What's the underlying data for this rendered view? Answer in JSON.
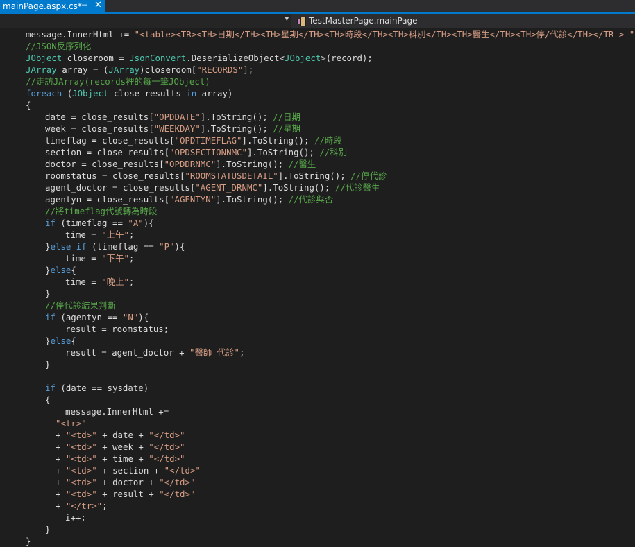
{
  "tab": {
    "title": "mainPage.aspx.cs*",
    "pin_glyph": "⊣",
    "close_glyph": "✕"
  },
  "navbar": {
    "member": "TestMasterPage.mainPage"
  },
  "code_lines": [
    {
      "indent": 0,
      "tokens": [
        [
          "pl",
          "message.InnerHtml += "
        ],
        [
          "st",
          "\"<table><TR><TH>日期</TH><TH>星期</TH><TH>時段</TH><TH>科別</TH><TH>醫生</TH><TH>停/代診</TH></TR > \""
        ],
        [
          "pl",
          ";"
        ]
      ]
    },
    {
      "indent": 0,
      "tokens": [
        [
          "cm",
          "//JSON反序列化"
        ]
      ]
    },
    {
      "indent": 0,
      "tokens": [
        [
          "ty",
          "JObject"
        ],
        [
          "pl",
          " closeroom = "
        ],
        [
          "ty",
          "JsonConvert"
        ],
        [
          "pl",
          ".DeserializeObject<"
        ],
        [
          "ty",
          "JObject"
        ],
        [
          "pl",
          ">(record);"
        ]
      ]
    },
    {
      "indent": 0,
      "tokens": [
        [
          "ty",
          "JArray"
        ],
        [
          "pl",
          " array = ("
        ],
        [
          "ty",
          "JArray"
        ],
        [
          "pl",
          ")closeroom["
        ],
        [
          "st",
          "\"RECORDS\""
        ],
        [
          "pl",
          "];"
        ]
      ]
    },
    {
      "indent": 0,
      "tokens": [
        [
          "cm",
          "//走訪JArray(records裡的每一筆JObject)"
        ]
      ]
    },
    {
      "indent": 0,
      "tokens": [
        [
          "kw",
          "foreach"
        ],
        [
          "pl",
          " ("
        ],
        [
          "ty",
          "JObject"
        ],
        [
          "pl",
          " close_results "
        ],
        [
          "kw",
          "in"
        ],
        [
          "pl",
          " array)"
        ]
      ]
    },
    {
      "indent": 0,
      "tokens": [
        [
          "pl",
          "{"
        ]
      ]
    },
    {
      "indent": 1,
      "tokens": [
        [
          "pl",
          "date = close_results["
        ],
        [
          "st",
          "\"OPDDATE\""
        ],
        [
          "pl",
          "].ToString(); "
        ],
        [
          "cm",
          "//日期"
        ]
      ]
    },
    {
      "indent": 1,
      "tokens": [
        [
          "pl",
          "week = close_results["
        ],
        [
          "st",
          "\"WEEKDAY\""
        ],
        [
          "pl",
          "].ToString(); "
        ],
        [
          "cm",
          "//星期"
        ]
      ]
    },
    {
      "indent": 1,
      "tokens": [
        [
          "pl",
          "timeflag = close_results["
        ],
        [
          "st",
          "\"OPDTIMEFLAG\""
        ],
        [
          "pl",
          "].ToString(); "
        ],
        [
          "cm",
          "//時段"
        ]
      ]
    },
    {
      "indent": 1,
      "tokens": [
        [
          "pl",
          "section = close_results["
        ],
        [
          "st",
          "\"OPDSECTIONNMC\""
        ],
        [
          "pl",
          "].ToString(); "
        ],
        [
          "cm",
          "//科別"
        ]
      ]
    },
    {
      "indent": 1,
      "tokens": [
        [
          "pl",
          "doctor = close_results["
        ],
        [
          "st",
          "\"OPDDRNMC\""
        ],
        [
          "pl",
          "].ToString(); "
        ],
        [
          "cm",
          "//醫生"
        ]
      ]
    },
    {
      "indent": 1,
      "tokens": [
        [
          "pl",
          "roomstatus = close_results["
        ],
        [
          "st",
          "\"ROOMSTATUSDETAIL\""
        ],
        [
          "pl",
          "].ToString(); "
        ],
        [
          "cm",
          "//停代診"
        ]
      ]
    },
    {
      "indent": 1,
      "tokens": [
        [
          "pl",
          "agent_doctor = close_results["
        ],
        [
          "st",
          "\"AGENT_DRNMC\""
        ],
        [
          "pl",
          "].ToString(); "
        ],
        [
          "cm",
          "//代診醫生"
        ]
      ]
    },
    {
      "indent": 1,
      "tokens": [
        [
          "pl",
          "agentyn = close_results["
        ],
        [
          "st",
          "\"AGENTYN\""
        ],
        [
          "pl",
          "].ToString(); "
        ],
        [
          "cm",
          "//代診與否"
        ]
      ]
    },
    {
      "indent": 1,
      "tokens": [
        [
          "cm",
          "//將timeflag代號轉為時段"
        ]
      ]
    },
    {
      "indent": 1,
      "tokens": [
        [
          "kw",
          "if"
        ],
        [
          "pl",
          " (timeflag == "
        ],
        [
          "st",
          "\"A\""
        ],
        [
          "pl",
          "){"
        ]
      ]
    },
    {
      "indent": 2,
      "tokens": [
        [
          "pl",
          "time = "
        ],
        [
          "st",
          "\"上午\""
        ],
        [
          "pl",
          ";"
        ]
      ]
    },
    {
      "indent": 1,
      "tokens": [
        [
          "pl",
          "}"
        ],
        [
          "kw",
          "else"
        ],
        [
          "pl",
          " "
        ],
        [
          "kw",
          "if"
        ],
        [
          "pl",
          " (timeflag == "
        ],
        [
          "st",
          "\"P\""
        ],
        [
          "pl",
          "){"
        ]
      ]
    },
    {
      "indent": 2,
      "tokens": [
        [
          "pl",
          "time = "
        ],
        [
          "st",
          "\"下午\""
        ],
        [
          "pl",
          ";"
        ]
      ]
    },
    {
      "indent": 1,
      "tokens": [
        [
          "pl",
          "}"
        ],
        [
          "kw",
          "else"
        ],
        [
          "pl",
          "{"
        ]
      ]
    },
    {
      "indent": 2,
      "tokens": [
        [
          "pl",
          "time = "
        ],
        [
          "st",
          "\"晚上\""
        ],
        [
          "pl",
          ";"
        ]
      ]
    },
    {
      "indent": 1,
      "tokens": [
        [
          "pl",
          "}"
        ]
      ]
    },
    {
      "indent": 1,
      "tokens": [
        [
          "cm",
          "//停代診結果判斷"
        ]
      ]
    },
    {
      "indent": 1,
      "tokens": [
        [
          "kw",
          "if"
        ],
        [
          "pl",
          " (agentyn == "
        ],
        [
          "st",
          "\"N\""
        ],
        [
          "pl",
          "){"
        ]
      ]
    },
    {
      "indent": 2,
      "tokens": [
        [
          "pl",
          "result = roomstatus;"
        ]
      ]
    },
    {
      "indent": 1,
      "tokens": [
        [
          "pl",
          "}"
        ],
        [
          "kw",
          "else"
        ],
        [
          "pl",
          "{"
        ]
      ]
    },
    {
      "indent": 2,
      "tokens": [
        [
          "pl",
          "result = agent_doctor + "
        ],
        [
          "st",
          "\"醫師 代診\""
        ],
        [
          "pl",
          ";"
        ]
      ]
    },
    {
      "indent": 1,
      "tokens": [
        [
          "pl",
          "}"
        ]
      ]
    },
    {
      "indent": 1,
      "tokens": []
    },
    {
      "indent": 1,
      "tokens": [
        [
          "kw",
          "if"
        ],
        [
          "pl",
          " (date == sysdate)"
        ]
      ]
    },
    {
      "indent": 1,
      "tokens": [
        [
          "pl",
          "{"
        ]
      ]
    },
    {
      "indent": 2,
      "tokens": [
        [
          "pl",
          "message.InnerHtml +="
        ]
      ]
    },
    {
      "indent": "c",
      "tokens": [
        [
          "st",
          "\"<tr>\""
        ]
      ]
    },
    {
      "indent": "c",
      "tokens": [
        [
          "pl",
          "+ "
        ],
        [
          "st",
          "\"<td>\""
        ],
        [
          "pl",
          " + date + "
        ],
        [
          "st",
          "\"</td>\""
        ]
      ]
    },
    {
      "indent": "c",
      "tokens": [
        [
          "pl",
          "+ "
        ],
        [
          "st",
          "\"<td>\""
        ],
        [
          "pl",
          " + week + "
        ],
        [
          "st",
          "\"</td>\""
        ]
      ]
    },
    {
      "indent": "c",
      "tokens": [
        [
          "pl",
          "+ "
        ],
        [
          "st",
          "\"<td>\""
        ],
        [
          "pl",
          " + time + "
        ],
        [
          "st",
          "\"</td>\""
        ]
      ]
    },
    {
      "indent": "c",
      "tokens": [
        [
          "pl",
          "+ "
        ],
        [
          "st",
          "\"<td>\""
        ],
        [
          "pl",
          " + section + "
        ],
        [
          "st",
          "\"</td>\""
        ]
      ]
    },
    {
      "indent": "c",
      "tokens": [
        [
          "pl",
          "+ "
        ],
        [
          "st",
          "\"<td>\""
        ],
        [
          "pl",
          " + doctor + "
        ],
        [
          "st",
          "\"</td>\""
        ]
      ]
    },
    {
      "indent": "c",
      "tokens": [
        [
          "pl",
          "+ "
        ],
        [
          "st",
          "\"<td>\""
        ],
        [
          "pl",
          " + result + "
        ],
        [
          "st",
          "\"</td>\""
        ]
      ]
    },
    {
      "indent": "c",
      "tokens": [
        [
          "pl",
          "+ "
        ],
        [
          "st",
          "\"</tr>\""
        ],
        [
          "pl",
          ";"
        ]
      ]
    },
    {
      "indent": 2,
      "tokens": [
        [
          "pl",
          "i++;"
        ]
      ]
    },
    {
      "indent": 1,
      "tokens": [
        [
          "pl",
          "}"
        ]
      ]
    },
    {
      "indent": 0,
      "tokens": [
        [
          "pl",
          "}"
        ]
      ]
    }
  ],
  "colors": {
    "keyword": "#569cd6",
    "type": "#4ec9b0",
    "string": "#d69d85",
    "comment": "#57a64a",
    "plain": "#dcdcdc",
    "background": "#1e1e1e",
    "accent": "#007acc"
  }
}
